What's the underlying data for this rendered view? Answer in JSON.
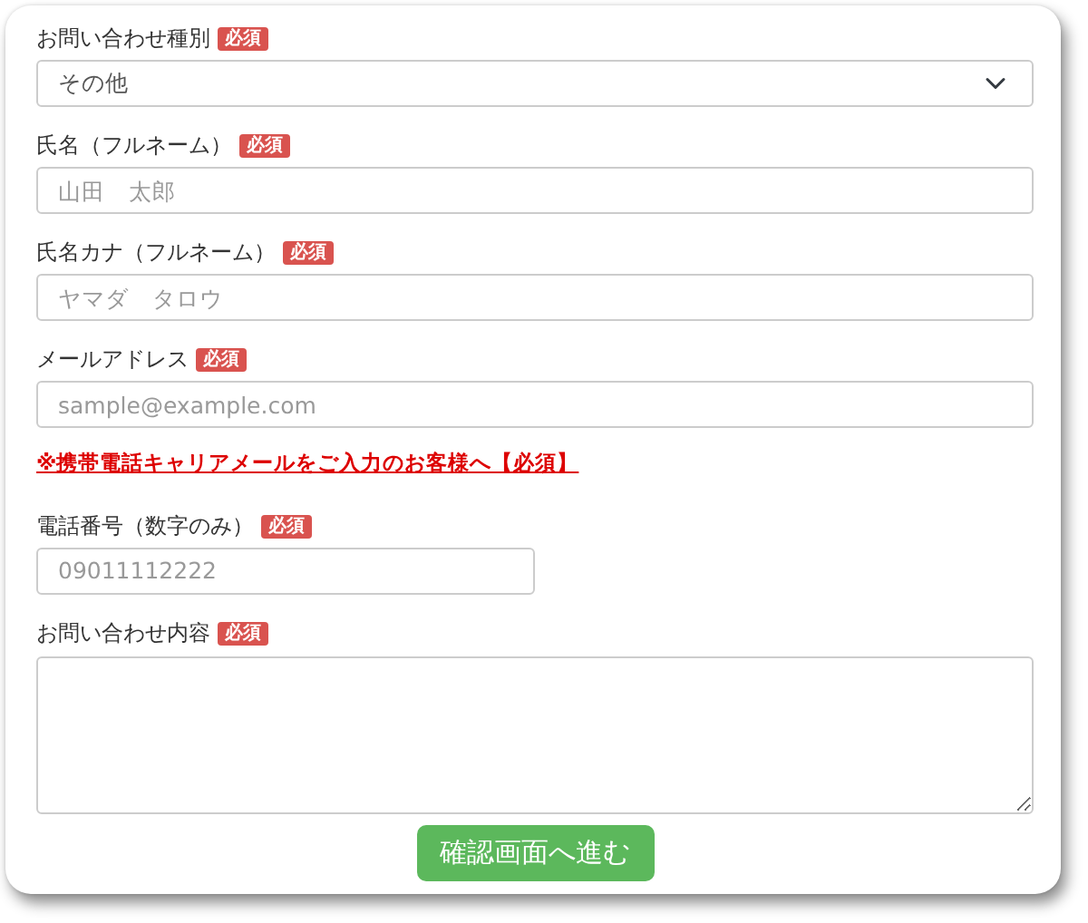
{
  "form": {
    "fields": [
      {
        "kind": "select",
        "label": "お問い合わせ種別",
        "required_badge": "必須",
        "value": "その他"
      },
      {
        "kind": "input",
        "label": "氏名（フルネーム）",
        "required_badge": "必須",
        "placeholder": "山田　太郎"
      },
      {
        "kind": "input",
        "label": "氏名カナ（フルネーム）",
        "required_badge": "必須",
        "placeholder": "ヤマダ　タロウ"
      },
      {
        "kind": "input",
        "label": "メールアドレス",
        "required_badge": "必須",
        "placeholder": "sample@example.com"
      },
      {
        "kind": "notice",
        "text": "※携帯電話キャリアメールをご入力のお客様へ【必須】"
      },
      {
        "kind": "short-input",
        "label": "電話番号（数字のみ）",
        "required_badge": "必須",
        "placeholder": "09011112222"
      },
      {
        "kind": "textarea",
        "label": "お問い合わせ内容",
        "required_badge": "必須"
      }
    ],
    "submit_button": "確認画面へ進む"
  }
}
